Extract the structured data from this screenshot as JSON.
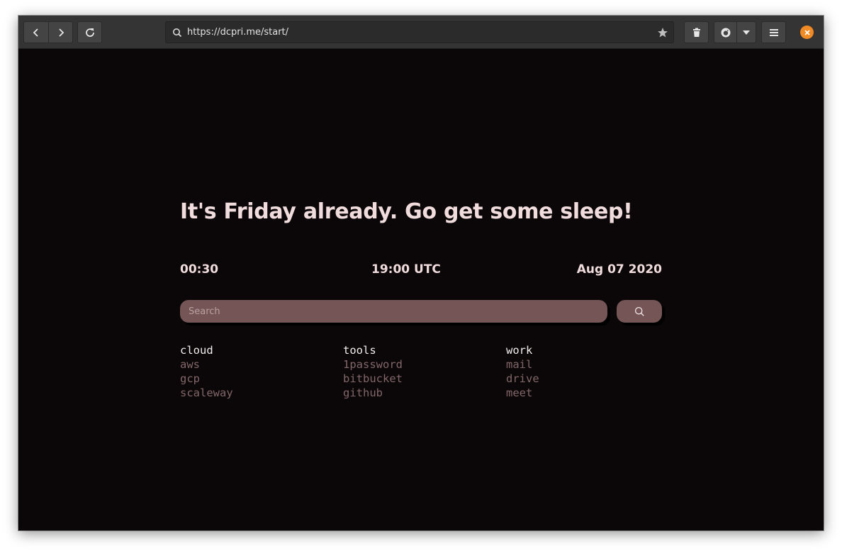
{
  "browser": {
    "url": "https://dcpri.me/start/",
    "accent": "#f08a24"
  },
  "page": {
    "headline": "It's Friday already. Go get some sleep!",
    "local_time": "00:30",
    "utc_time": "19:00 UTC",
    "date": "Aug 07 2020",
    "search": {
      "placeholder": "Search",
      "value": ""
    },
    "colors": {
      "background": "#0b0607",
      "text": "#f0dcdc",
      "accent": "#755556",
      "link": "#82676a"
    },
    "link_groups": [
      {
        "title": "cloud",
        "links": [
          "aws",
          "gcp",
          "scaleway"
        ]
      },
      {
        "title": "tools",
        "links": [
          "1password",
          "bitbucket",
          "github"
        ]
      },
      {
        "title": "work",
        "links": [
          "mail",
          "drive",
          "meet"
        ]
      }
    ]
  }
}
